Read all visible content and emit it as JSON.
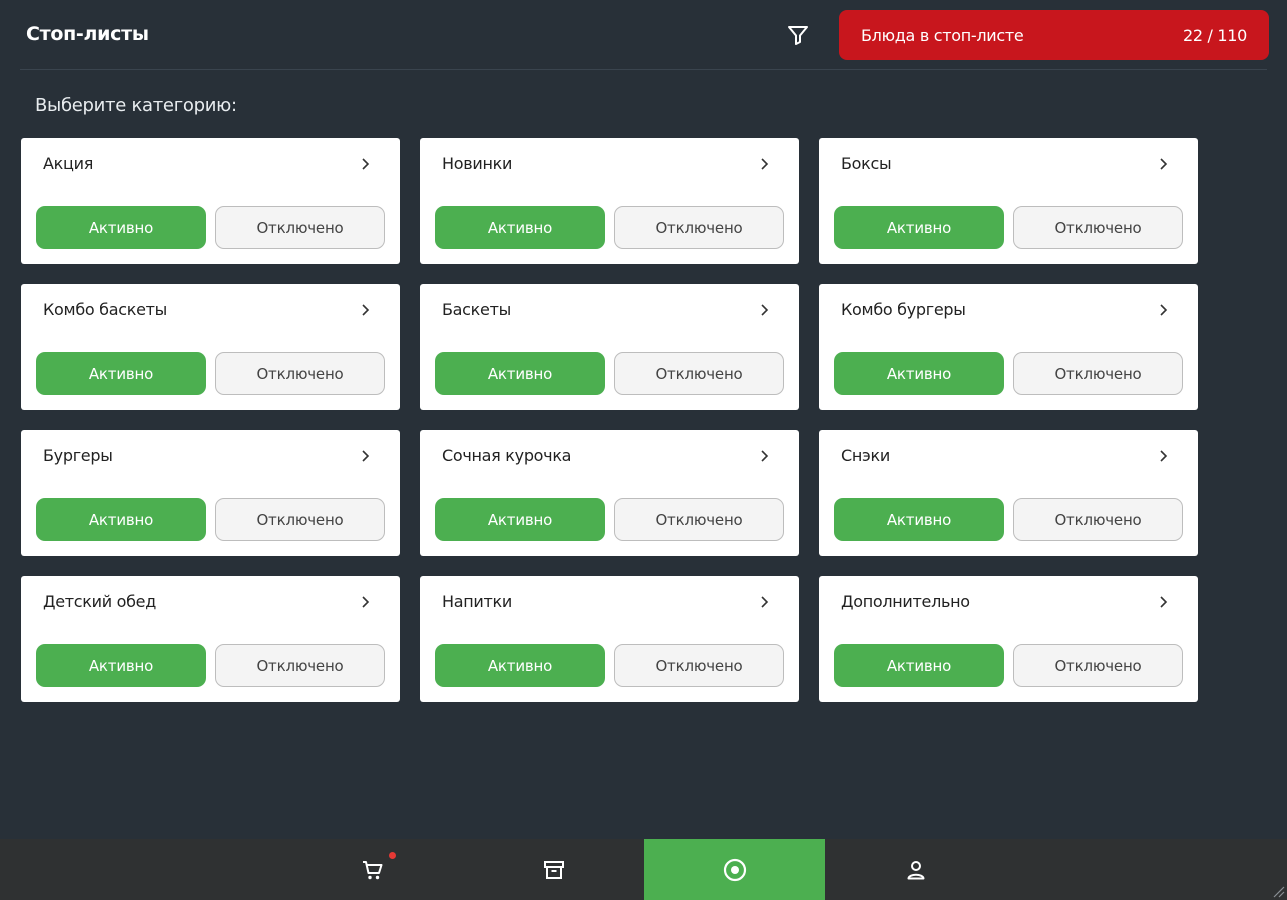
{
  "header": {
    "title": "Стоп-листы",
    "filter_icon": "filter-icon",
    "stop_badge": {
      "label": "Блюда в стоп-листе",
      "count": "22 / 110",
      "color": "#c8161d"
    }
  },
  "main": {
    "section_label": "Выберите категорию:",
    "categories": [
      {
        "title": "Акция",
        "active_label": "Активно",
        "off_label": "Отключено"
      },
      {
        "title": "Новинки",
        "active_label": "Активно",
        "off_label": "Отключено"
      },
      {
        "title": "Боксы",
        "active_label": "Активно",
        "off_label": "Отключено"
      },
      {
        "title": "Комбо баскеты",
        "active_label": "Активно",
        "off_label": "Отключено"
      },
      {
        "title": "Баскеты",
        "active_label": "Активно",
        "off_label": "Отключено"
      },
      {
        "title": "Комбо бургеры",
        "active_label": "Активно",
        "off_label": "Отключено"
      },
      {
        "title": "Бургеры",
        "active_label": "Активно",
        "off_label": "Отключено"
      },
      {
        "title": "Сочная курочка",
        "active_label": "Активно",
        "off_label": "Отключено"
      },
      {
        "title": "Снэки",
        "active_label": "Активно",
        "off_label": "Отключено"
      },
      {
        "title": "Детский обед",
        "active_label": "Активно",
        "off_label": "Отключено"
      },
      {
        "title": "Напитки",
        "active_label": "Активно",
        "off_label": "Отключено"
      },
      {
        "title": "Дополнительно",
        "active_label": "Активно",
        "off_label": "Отключено"
      }
    ]
  },
  "bottom_nav": {
    "items": [
      {
        "icon": "cart-icon",
        "active": false,
        "has_notification": true
      },
      {
        "icon": "archive-icon",
        "active": false,
        "has_notification": false
      },
      {
        "icon": "stop-circle-icon",
        "active": true,
        "has_notification": false
      },
      {
        "icon": "user-icon",
        "active": false,
        "has_notification": false
      }
    ]
  },
  "colors": {
    "background": "#283038",
    "accent_green": "#4caf50",
    "alert_red": "#c8161d",
    "bottom_bar": "#2f3132"
  }
}
